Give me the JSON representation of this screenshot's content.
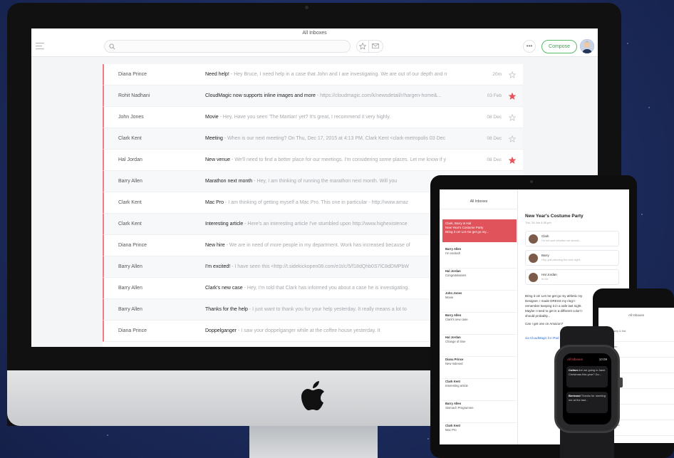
{
  "window": {
    "title": "All Inboxes"
  },
  "toolbar": {
    "search_placeholder": "",
    "compose_label": "Compose",
    "more_label": "•••"
  },
  "colors": {
    "accent_red": "#e0535b",
    "compose_green": "#3aa34f"
  },
  "emails": [
    {
      "sender": "Diana Prince",
      "subject": "Need help!",
      "preview": "- Hey Bruce, I need help in a case that John and I are investigating. We are out of our depth and n",
      "date": "20m",
      "starred": false
    },
    {
      "sender": "Rohit Nadhani",
      "subject": "CloudMagic now supports inline images and more",
      "preview": "- https://cloudmagic.com/k/newsdetail/r/hargen-home&...",
      "date": "03 Feb",
      "starred": true
    },
    {
      "sender": "John Jones",
      "subject": "Movie",
      "preview": "- Hey, Have you seen 'The Martian' yet? It's great, I recommend it very highly.",
      "date": "08 Dec",
      "starred": false
    },
    {
      "sender": "Clark Kent",
      "subject": "Meeting",
      "preview": "- When is our next meeting? On Thu, Dec 17, 2015 at 4:13 PM, Clark Kent <clark-metropolis 03 Dec",
      "date": "08 Dec",
      "starred": false
    },
    {
      "sender": "Hal Jordan",
      "subject": "New venue",
      "preview": "- We'll need to find a better place for our meetings. I'm considering some places. Let me know if y",
      "date": "08 Dec",
      "starred": true
    },
    {
      "sender": "Barry Allen",
      "subject": "Marathon next month",
      "preview": "- Hey, I am thinking of running the marathon next month. Will you",
      "date": "",
      "starred": false
    },
    {
      "sender": "Clark Kent",
      "subject": "Mac Pro",
      "preview": "- I am thinking of getting myself a Mac Pro. This one in particular - http://www.amaz",
      "date": "",
      "starred": false
    },
    {
      "sender": "Clark Kent",
      "subject": "Interesting article",
      "preview": "- Here's an interesting article I've stumbled upon http://www.highexistence",
      "date": "",
      "starred": false
    },
    {
      "sender": "Diana Prince",
      "subject": "New hire",
      "preview": "- We are in need of more people in my department. Work has increased because of",
      "date": "",
      "starred": false
    },
    {
      "sender": "Barry Allen",
      "subject": "I'm excited!",
      "preview": "- I have seen this <http://t.sidekickopen08.com/e1t/c/5/f18dQhb0S7lC8dDMPbW",
      "date": "",
      "starred": false
    },
    {
      "sender": "Barry Allen",
      "subject": "Clark's new case",
      "preview": "- Hey, I'm told that Clark has informed you about a case he is investigating.",
      "date": "",
      "starred": false
    },
    {
      "sender": "Barry Allen",
      "subject": "Thanks for the help",
      "preview": "- I just want to thank you for your help yesterday. It really means a lot to",
      "date": "",
      "starred": false
    },
    {
      "sender": "Diana Prince",
      "subject": "Doppelganger",
      "preview": "- I saw your doppelganger while at the coffee house yesterday. It",
      "date": "",
      "starred": false
    }
  ],
  "ipad": {
    "list_title": "All Inboxes",
    "selected": {
      "from": "Clark, Barry & Hal",
      "subject": "New Year's Costume Party",
      "preview": "Bring it on! Let me get go my..."
    },
    "items": [
      {
        "from": "Barry Allen",
        "subject": "I'm excited!"
      },
      {
        "from": "Hal Jordan",
        "subject": "Congratulations"
      },
      {
        "from": "John Jones",
        "subject": "Movie"
      },
      {
        "from": "Barry Allen",
        "subject": "Clark's new case"
      },
      {
        "from": "Hal Jordan",
        "subject": "Change of time"
      },
      {
        "from": "Diana Prince",
        "subject": "New Indexed"
      },
      {
        "from": "Clark Kent",
        "subject": "Interesting article"
      },
      {
        "from": "Barry Allen",
        "subject": "Stomach Programme"
      },
      {
        "from": "Clark Kent",
        "subject": "Mac Pro"
      }
    ],
    "thread_subject": "New Year's Costume Party",
    "thread_date": "Thu, 26 Jun 4:30 pm",
    "messages": [
      {
        "name": "Clark",
        "text": "I'm not sure whether we should..."
      },
      {
        "name": "Barry",
        "text": "Hey, just planning the next night..."
      },
      {
        "name": "Hal Jordan",
        "text": "to me"
      }
    ],
    "body": "Bring it on! Let me get go my athletic my Designer. I made DRESS my ring! I remember keeping it in a safe last night. Maybe I need to get in a different color! I should probably...",
    "body_q": "Can I get one on Amazon?",
    "link": "via CloudMagic for iPad"
  },
  "iphone": {
    "title": "All Inboxes",
    "items": [
      "Clark, Barry & Hal",
      "Barry Allen",
      "Hal Jordan",
      "John Jones",
      "Barry Allen",
      "Hal Jordan",
      "Diana Prince"
    ]
  },
  "watch": {
    "title": "All Inboxes",
    "time": "10:09",
    "cards": [
      {
        "from": "Cotton",
        "text": "Are we going to have Christmas this year? Do..."
      },
      {
        "from": "Bertrand",
        "text": "Thanks for meeting me at the last..."
      }
    ]
  }
}
